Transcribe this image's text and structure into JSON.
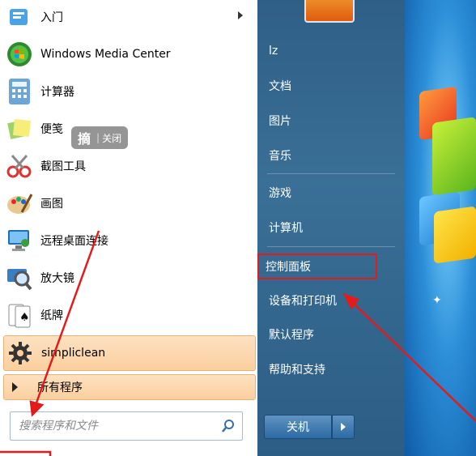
{
  "programs": [
    {
      "label": "入门",
      "icon": "getting-started-icon",
      "has_submenu": true
    },
    {
      "label": "Windows Media Center",
      "icon": "windows-media-center-icon"
    },
    {
      "label": "计算器",
      "icon": "calculator-icon"
    },
    {
      "label": "便笺",
      "icon": "sticky-notes-icon"
    },
    {
      "label": "截图工具",
      "icon": "snipping-tool-icon"
    },
    {
      "label": "画图",
      "icon": "paint-icon"
    },
    {
      "label": "远程桌面连接",
      "icon": "remote-desktop-icon"
    },
    {
      "label": "放大镜",
      "icon": "magnifier-icon"
    },
    {
      "label": "纸牌",
      "icon": "solitaire-icon"
    },
    {
      "label": "simpliclean",
      "icon": "gear-icon",
      "highlighted": true
    }
  ],
  "overlay_badge": {
    "main": "摘",
    "sep": "|",
    "action": "关闭"
  },
  "all_programs": "所有程序",
  "search": {
    "placeholder": "搜索程序和文件"
  },
  "right_items": [
    {
      "label": "lz"
    },
    {
      "label": "文档"
    },
    {
      "label": "图片"
    },
    {
      "label": "音乐"
    },
    {
      "label": "游戏"
    },
    {
      "label": "计算机"
    },
    {
      "label": "控制面板",
      "highlighted": true
    },
    {
      "label": "设备和打印机"
    },
    {
      "label": "默认程序"
    },
    {
      "label": "帮助和支持"
    }
  ],
  "shutdown": {
    "label": "关机"
  },
  "colors": {
    "annotation_red": "#e21b1b",
    "highlight_orange": "#fbcf9e",
    "right_pane_blue": "#2f5f86"
  }
}
